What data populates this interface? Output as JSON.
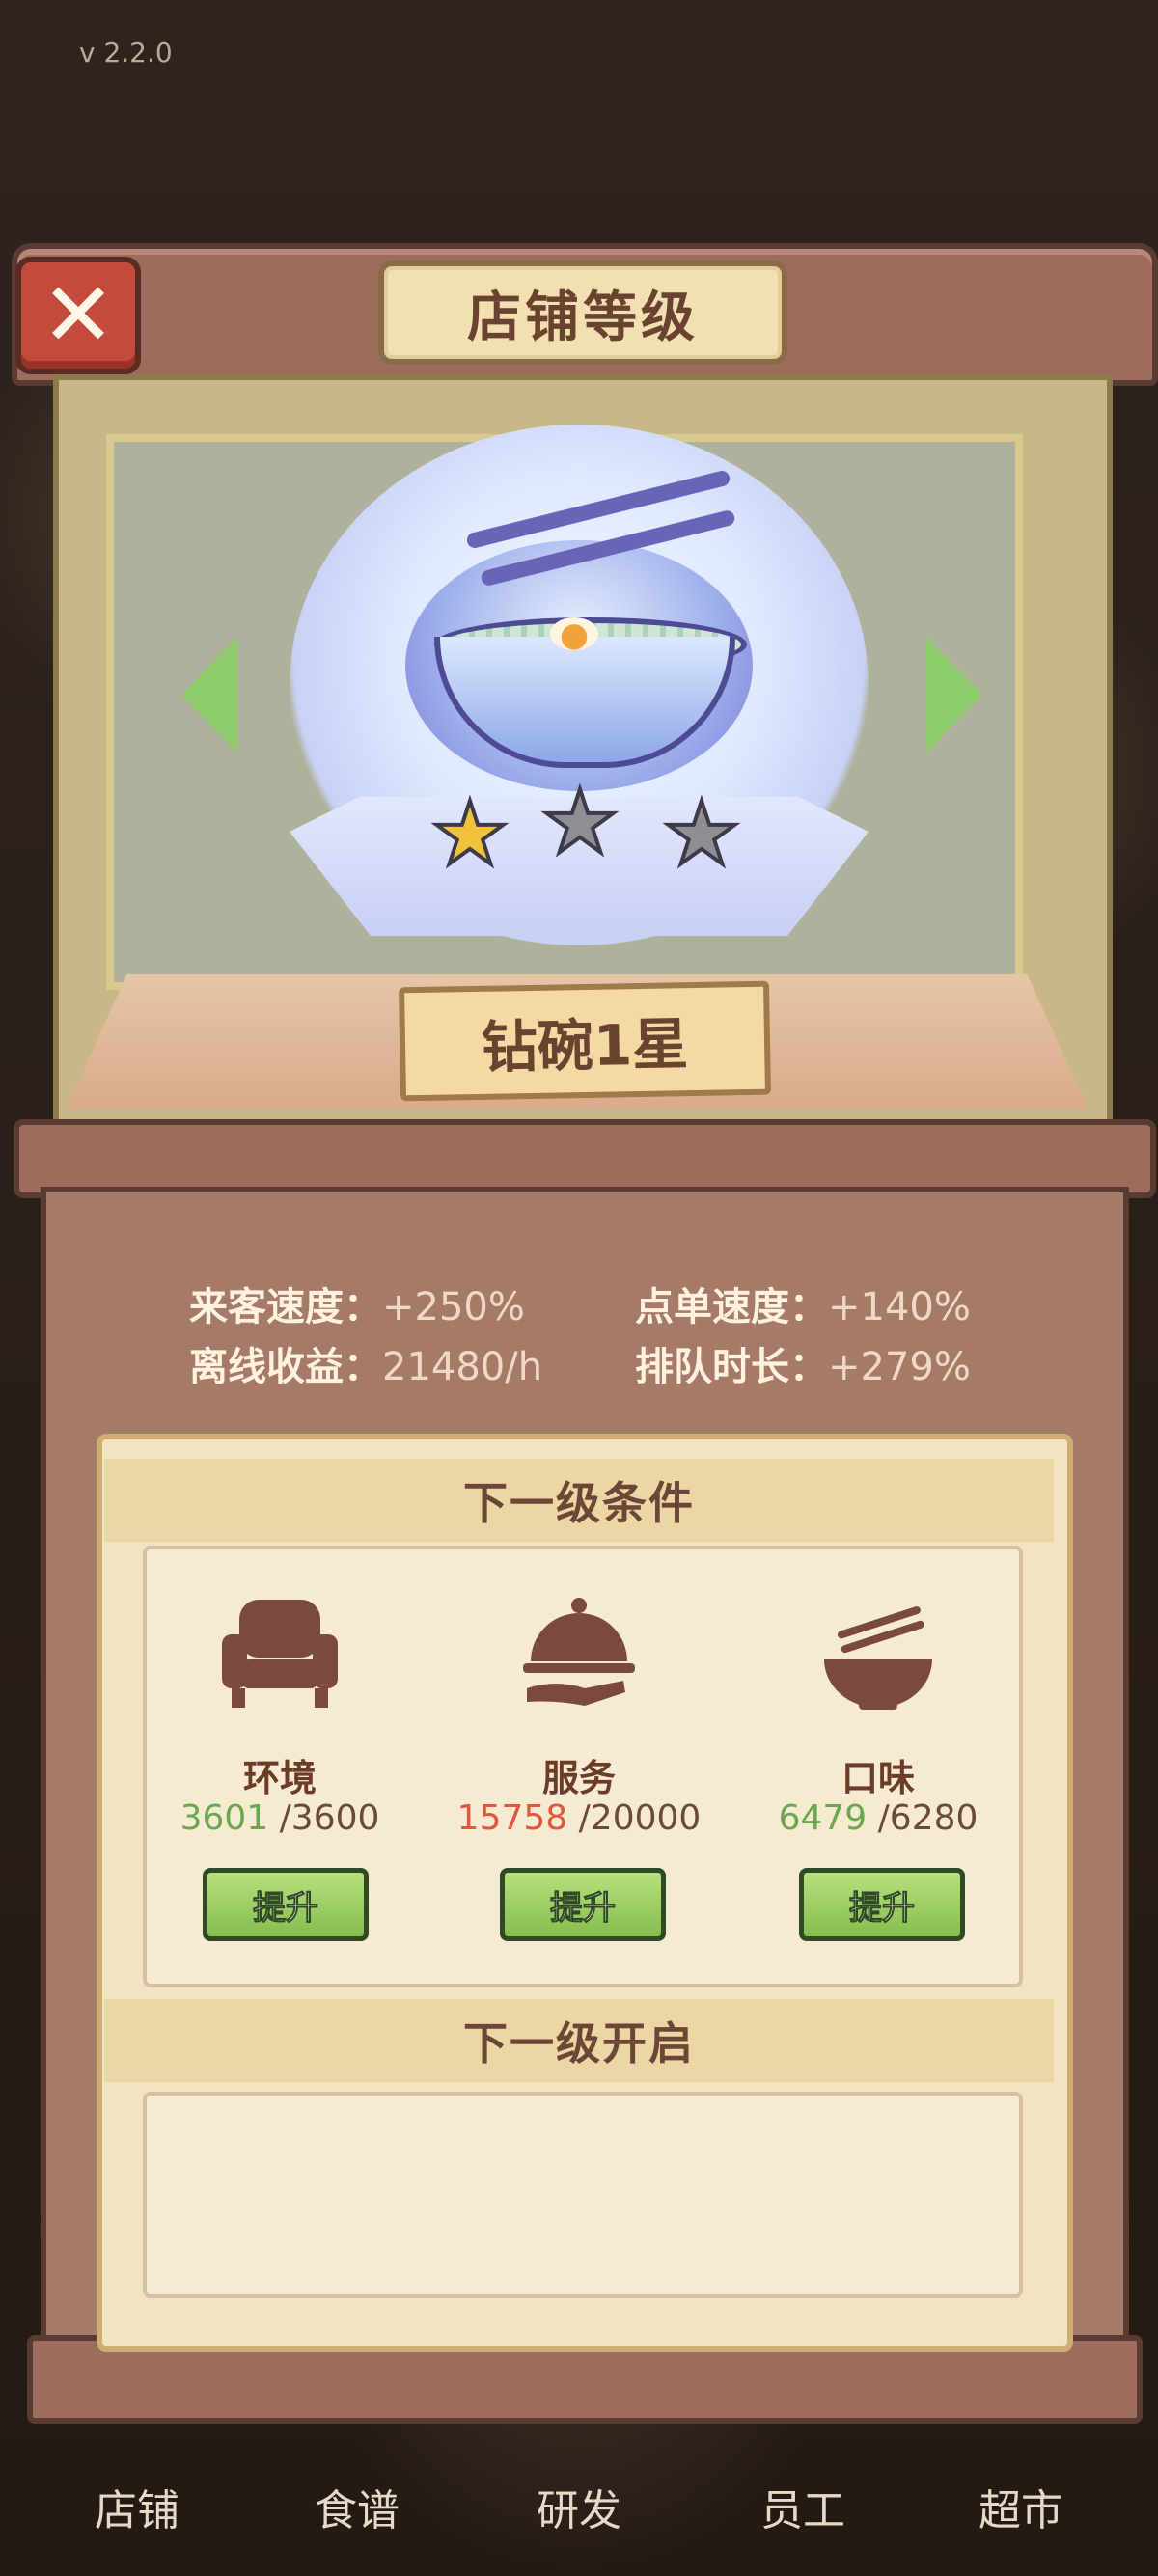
{
  "version": "v  2.2.0",
  "dialog": {
    "title": "店铺等级",
    "level_name": "钻碗1星",
    "stars": {
      "earned": 1,
      "total": 3
    }
  },
  "stats": [
    {
      "label": "来客速度：",
      "value": "+250%"
    },
    {
      "label": "点单速度：",
      "value": "+140%"
    },
    {
      "label": "离线收益：",
      "value": "21480/h"
    },
    {
      "label": "排队时长：",
      "value": "+279%"
    }
  ],
  "next_level": {
    "conditions_title": "下一级条件",
    "unlock_title": "下一级开启",
    "conditions": [
      {
        "label": "环境",
        "current": "3601",
        "max": "/3600",
        "button": "提升",
        "icon": "armchair-icon"
      },
      {
        "label": "服务",
        "current": "15758",
        "max": "/20000",
        "button": "提升",
        "icon": "cloche-icon"
      },
      {
        "label": "口味",
        "current": "6479",
        "max": "/6280",
        "button": "提升",
        "icon": "noodle-bowl-icon"
      }
    ]
  },
  "nav": [
    "店铺",
    "食谱",
    "研发",
    "员工",
    "超市"
  ],
  "colors": {
    "progress_met": "#6aa84f",
    "progress_unmet": "#e0563e",
    "frame_wood": "#9c6d5c"
  }
}
